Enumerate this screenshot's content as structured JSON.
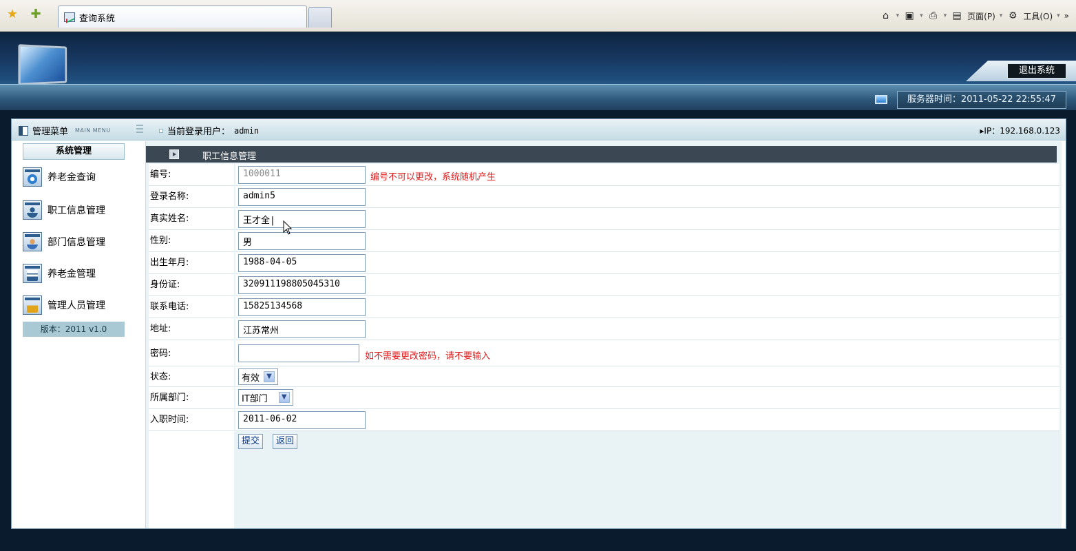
{
  "browser": {
    "tab_title": "查询系统",
    "page_menu": "页面(P)",
    "tools_menu": "工具(O)",
    "overflow": "»"
  },
  "header": {
    "logout": "退出系统",
    "server_time_label": "服务器时间：",
    "server_time_value": "2011-05-22 22:55:47"
  },
  "topbar": {
    "menu_title": "管理菜单",
    "menu_sub": "MAIN MENU",
    "user_label": "当前登录用户：",
    "user_value": "admin",
    "ip_label": "IP：",
    "ip_value": "192.168.0.123"
  },
  "sidebar": {
    "head": "系统管理",
    "items": [
      {
        "label": "养老金查询"
      },
      {
        "label": "职工信息管理"
      },
      {
        "label": "部门信息管理"
      },
      {
        "label": "养老金管理"
      },
      {
        "label": "管理人员管理"
      }
    ],
    "version": "版本：2011 v1.0"
  },
  "content": {
    "title": "职工信息管理"
  },
  "form": {
    "id": {
      "label": "编号:",
      "value": "1000011",
      "hint": "编号不可以更改，系统随机产生"
    },
    "login_name": {
      "label": "登录名称:",
      "value": "admin5"
    },
    "real_name": {
      "label": "真实姓名:",
      "value": "王才全|"
    },
    "gender": {
      "label": "性别:",
      "value": "男"
    },
    "birth": {
      "label": "出生年月:",
      "value": "1988-04-05"
    },
    "id_card": {
      "label": "身份证:",
      "value": "320911198805045310"
    },
    "phone": {
      "label": "联系电话:",
      "value": "15825134568"
    },
    "address": {
      "label": "地址:",
      "value": "江苏常州"
    },
    "password": {
      "label": "密码:",
      "value": "",
      "hint": "如不需要更改密码，请不要输入"
    },
    "status": {
      "label": "状态:",
      "value": "有效"
    },
    "department": {
      "label": "所属部门:",
      "value": "IT部门"
    },
    "hire_date": {
      "label": "入职时间:",
      "value": "2011-06-02"
    },
    "submit": "提交",
    "back": "返回"
  }
}
